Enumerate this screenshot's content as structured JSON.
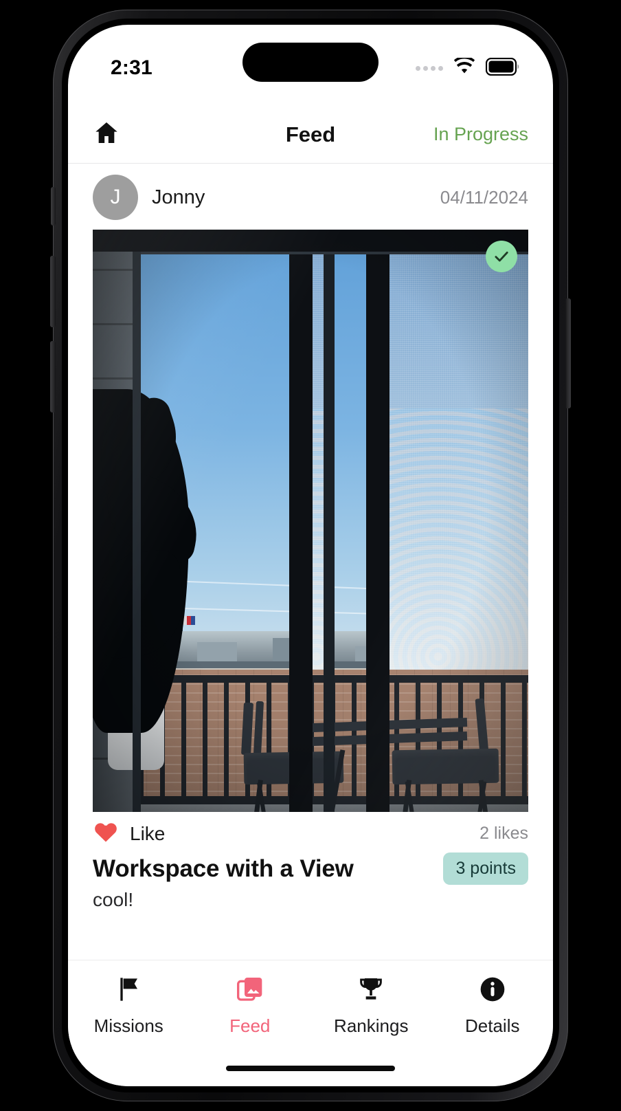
{
  "status_bar": {
    "time": "2:31",
    "signal_icon": "signal-dots-icon",
    "wifi_icon": "wifi-icon",
    "battery_icon": "battery-icon"
  },
  "nav": {
    "home_icon": "home-icon",
    "title": "Feed",
    "status_label": "In Progress",
    "status_color": "#66a351"
  },
  "post": {
    "avatar_initial": "J",
    "author": "Jonny",
    "date": "04/11/2024",
    "completed_icon": "check-circle-icon",
    "completed_color": "#8fdfa6",
    "photo_alt": "View through sliding glass balcony doors onto a balcony with two black folding bistro chairs, a metal railing, a brick building and blue sky beyond",
    "like_icon": "heart-icon",
    "like_color": "#ef5350",
    "like_label": "Like",
    "likes_count": "2 likes",
    "title": "Workspace with a View",
    "points_badge": "3 points",
    "points_badge_color": "#b2ddd6",
    "caption": "cool!"
  },
  "tabs": [
    {
      "icon": "flag-icon",
      "label": "Missions",
      "active": false
    },
    {
      "icon": "photos-icon",
      "label": "Feed",
      "active": true
    },
    {
      "icon": "trophy-icon",
      "label": "Rankings",
      "active": false
    },
    {
      "icon": "info-icon",
      "label": "Details",
      "active": false
    }
  ],
  "tab_active_color": "#f2647a"
}
